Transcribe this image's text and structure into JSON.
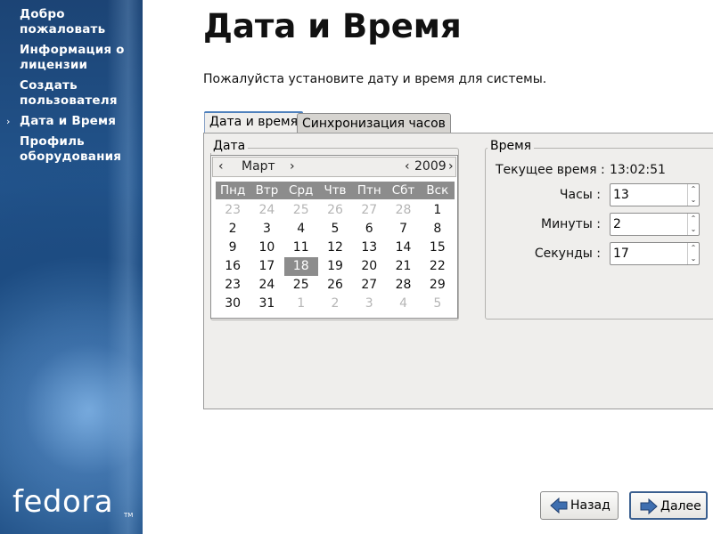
{
  "sidebar": {
    "items": [
      {
        "label": "Добро пожаловать",
        "active": false
      },
      {
        "label": "Информация о лицензии",
        "active": false
      },
      {
        "label": "Создать пользователя",
        "active": false
      },
      {
        "label": "Дата и Время",
        "active": true
      },
      {
        "label": "Профиль оборудования",
        "active": false
      }
    ],
    "active_marker": "›",
    "logo_text": "fedora",
    "logo_tm": "TM"
  },
  "header": {
    "title": "Дата и Время",
    "instructions": "Пожалуйста установите дату и время для системы."
  },
  "tabs": [
    {
      "label": "Дата и время",
      "selected": true
    },
    {
      "label": "Синхронизация часов",
      "selected": false
    }
  ],
  "date_frame": {
    "label": "Дата",
    "calendar": {
      "month": "Март",
      "year": "2009",
      "prev_month_icon": "‹",
      "next_month_icon": "›",
      "weekdays": [
        "Пнд",
        "Втр",
        "Срд",
        "Чтв",
        "Птн",
        "Сбт",
        "Вск"
      ],
      "weeks": [
        [
          "23",
          "24",
          "25",
          "26",
          "27",
          "28",
          "1"
        ],
        [
          "2",
          "3",
          "4",
          "5",
          "6",
          "7",
          "8"
        ],
        [
          "9",
          "10",
          "11",
          "12",
          "13",
          "14",
          "15"
        ],
        [
          "16",
          "17",
          "18",
          "19",
          "20",
          "21",
          "22"
        ],
        [
          "23",
          "24",
          "25",
          "26",
          "27",
          "28",
          "29"
        ],
        [
          "30",
          "31",
          "1",
          "2",
          "3",
          "4",
          "5"
        ]
      ],
      "selected_day": "18"
    }
  },
  "time_frame": {
    "label": "Время",
    "current_time_label": "Текущее время :",
    "current_time_value": "13:02:51",
    "hours_label": "Часы :",
    "hours_value": "13",
    "minutes_label": "Минуты :",
    "minutes_value": "2",
    "seconds_label": "Секунды :",
    "seconds_value": "17"
  },
  "buttons": {
    "back_label": "Назад",
    "next_label": "Далее"
  },
  "colors": {
    "sidebar_bg": "#1f4f86",
    "calendar_header": "#8c8c8c",
    "arrow_blue": "#3f6fb0"
  }
}
